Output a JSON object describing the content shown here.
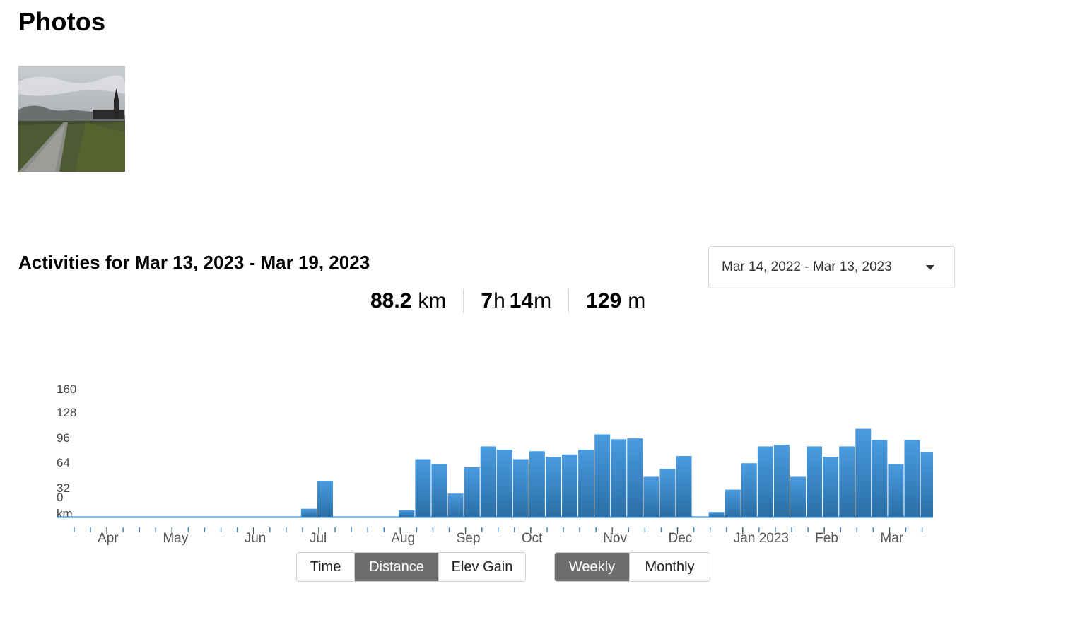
{
  "photos": {
    "title": "Photos",
    "thumbnail_alt": "Photo of a path toward a church tower"
  },
  "activities": {
    "title": "Activities for Mar 13, 2023 - Mar 19, 2023",
    "range_select": {
      "selected": "Mar 14, 2022 - Mar 13, 2023"
    }
  },
  "stats": {
    "distance": {
      "value": "88.2",
      "unit": "km"
    },
    "time": {
      "hours": "7",
      "h_unit": "h",
      "minutes": "14",
      "m_unit": "m"
    },
    "elevation": {
      "value": "129",
      "unit": "m"
    }
  },
  "colors": {
    "bar_top": "#4a9be0",
    "bar_bottom": "#2a6fa6",
    "bar_selected_top": "#1c5a88",
    "bar_selected_bottom": "#06121c",
    "baseline": "#2f7fbf",
    "active_button": "#6d6d6d"
  },
  "chart_data": {
    "type": "bar",
    "y_axis_labels": [
      "160",
      "128",
      "96",
      "64",
      "32",
      "0",
      "km"
    ],
    "ylim": [
      0,
      160
    ],
    "month_labels": [
      "Apr",
      "May",
      "Jun",
      "Jul",
      "Aug",
      "Sep",
      "Oct",
      "Nov",
      "Dec",
      "Jan 2023",
      "Feb",
      "Mar"
    ],
    "month_start_week_index": [
      2,
      6,
      11,
      15,
      20,
      24,
      28,
      33,
      37,
      41,
      46,
      50
    ],
    "values": [
      0,
      0,
      0,
      0,
      0,
      0,
      0,
      0,
      0,
      0,
      0,
      0,
      0,
      10,
      45,
      0,
      0,
      0,
      0,
      8,
      72,
      66,
      29,
      62,
      88,
      84,
      72,
      82,
      75,
      78,
      84,
      103,
      97,
      98,
      50,
      60,
      76,
      0,
      6,
      34,
      67,
      88,
      90,
      50,
      88,
      75,
      88,
      110,
      96,
      66,
      96,
      81,
      88
    ],
    "selected_index": 52
  },
  "controls": {
    "metric_buttons": [
      "Time",
      "Distance",
      "Elev Gain"
    ],
    "metric_active": "Distance",
    "period_buttons": [
      "Weekly",
      "Monthly"
    ],
    "period_active": "Weekly"
  }
}
